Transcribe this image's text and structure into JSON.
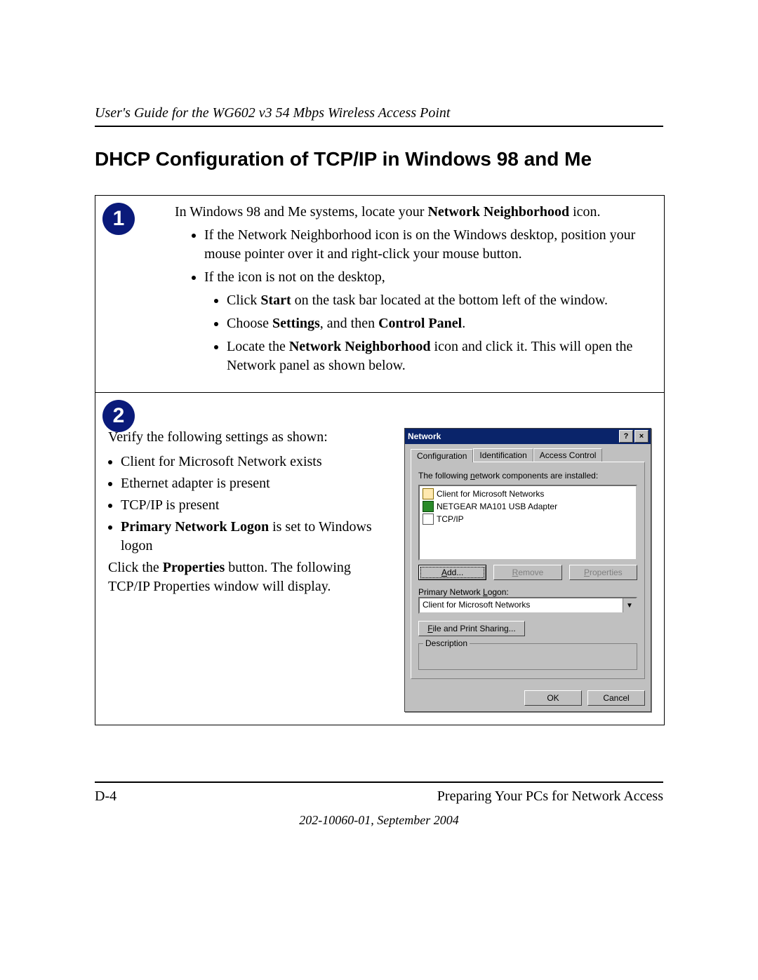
{
  "header": {
    "running_title": "User's Guide for the WG602 v3 54 Mbps Wireless Access Point"
  },
  "title": "DHCP Configuration of TCP/IP in Windows 98 and Me",
  "steps": [
    {
      "badge": "1",
      "intro_pre": "In Windows 98 and Me systems, locate your ",
      "intro_bold": "Network Neighborhood",
      "intro_post": " icon.",
      "bullets_l1": [
        "If the Network Neighborhood icon is on the Windows desktop, position your mouse pointer over it and right-click your mouse button.",
        "If the icon is not on the desktop,"
      ],
      "bullets_l2": [
        {
          "pre": "Click ",
          "bold": "Start",
          "post": " on the task bar located at the bottom left of the window."
        },
        {
          "pre": "Choose ",
          "bold": "Settings",
          "mid": ", and then ",
          "bold2": "Control Panel",
          "post": "."
        },
        {
          "pre": "Locate the ",
          "bold": "Network Neighborhood",
          "post": " icon and click it. This will open the Network panel as shown below."
        }
      ]
    },
    {
      "badge": "2",
      "left": {
        "intro": "Verify the following settings as shown:",
        "bullets": [
          "Client for Microsoft Network exists",
          "Ethernet adapter is present",
          "TCP/IP is present"
        ],
        "bullet4_bold": "Primary Network Logon",
        "bullet4_post": " is set to Windows logon",
        "para2_pre": "Click the ",
        "para2_bold": "Properties",
        "para2_post": " button. The following TCP/IP Properties window will display."
      },
      "dialog": {
        "title": "Network",
        "help_glyph": "?",
        "close_glyph": "×",
        "tabs": [
          "Configuration",
          "Identification",
          "Access Control"
        ],
        "panel_text_pre": "The following ",
        "panel_text_under": "n",
        "panel_text_post": "etwork components are installed:",
        "components": [
          {
            "icon": "client",
            "label": "Client for Microsoft Networks"
          },
          {
            "icon": "adapter",
            "label": "NETGEAR MA101 USB Adapter"
          },
          {
            "icon": "proto",
            "label": "TCP/IP"
          }
        ],
        "buttons": {
          "add_u": "A",
          "add": "dd...",
          "remove_u": "R",
          "remove": "emove",
          "properties_u": "P",
          "properties": "roperties"
        },
        "logon_label_pre": "Primary Network ",
        "logon_label_under": "L",
        "logon_label_post": "ogon:",
        "logon_value": "Client for Microsoft Networks",
        "fps_under": "F",
        "fps_label": "ile and Print Sharing...",
        "desc_legend": "Description",
        "ok": "OK",
        "cancel": "Cancel"
      }
    }
  ],
  "footer": {
    "left": "D-4",
    "right": "Preparing Your PCs for Network Access",
    "center": "202-10060-01, September 2004"
  }
}
